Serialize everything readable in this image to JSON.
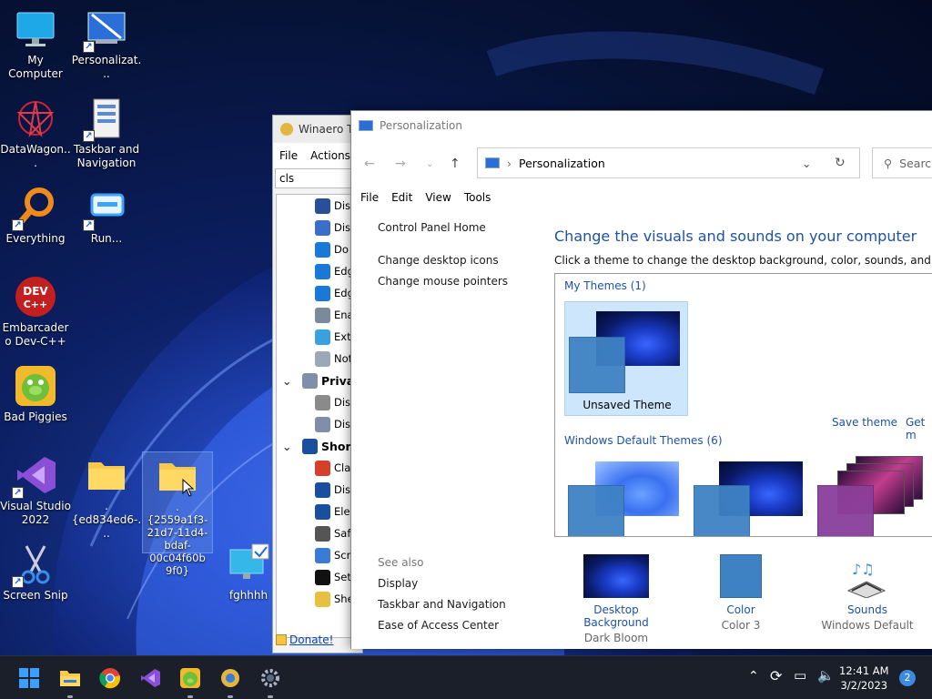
{
  "desktop": {
    "icons": [
      {
        "label": "My Computer"
      },
      {
        "label": "Personalizat..."
      },
      {
        "label": "DataWagon..."
      },
      {
        "label": "Taskbar and Navigation"
      },
      {
        "label": "Everything"
      },
      {
        "label": "Run..."
      },
      {
        "label": "Embarcadero Dev-C++"
      },
      {
        "label": "Bad Piggies"
      },
      {
        "label": "Visual Studio 2022"
      },
      {
        "label": ".{ed834ed6-..."
      },
      {
        "label": ".{2559a1f3-21d7-11d4-bdaf-00c04f60b9f0}"
      },
      {
        "label": "Screen Snip"
      },
      {
        "label": "fghhhh"
      }
    ],
    "devcpp_logo_text": "DEV C++"
  },
  "winaero": {
    "title": "Winaero Tw",
    "menu": [
      "File",
      "Actions"
    ],
    "search_value": "cls",
    "tree": [
      {
        "label": "Dis",
        "icon": "circle-icon"
      },
      {
        "label": "Dis",
        "icon": "brush-icon"
      },
      {
        "label": "Do",
        "icon": "edge-icon"
      },
      {
        "label": "Edg",
        "icon": "edge-icon"
      },
      {
        "label": "Edg",
        "icon": "edge-icon"
      },
      {
        "label": "Ena",
        "icon": "tools-icon"
      },
      {
        "label": "Ext",
        "icon": "ie-icon"
      },
      {
        "label": "Not",
        "icon": "notepad-icon"
      },
      {
        "label": "Privac",
        "icon": "shield-icon",
        "group": true
      },
      {
        "label": "Dis",
        "icon": "eye-icon"
      },
      {
        "label": "Dis",
        "icon": "shield-icon"
      },
      {
        "label": "Shortc",
        "icon": "shortcut-icon",
        "group": true
      },
      {
        "label": "Cla",
        "icon": "power-icon"
      },
      {
        "label": "Dis",
        "icon": "shortcut-icon"
      },
      {
        "label": "Ele",
        "icon": "shortcut-icon"
      },
      {
        "label": "Saf",
        "icon": "display-icon"
      },
      {
        "label": "Scr",
        "icon": "scissors-icon"
      },
      {
        "label": "Set",
        "icon": "gear-icon"
      },
      {
        "label": "She",
        "icon": "folder-icon"
      }
    ],
    "donate": "Donate!"
  },
  "personalization": {
    "title": "Personalization",
    "breadcrumb": "Personalization",
    "search_placeholder": "Searc",
    "menu": [
      "File",
      "Edit",
      "View",
      "Tools"
    ],
    "left_links": [
      "Control Panel Home",
      "Change desktop icons",
      "Change mouse pointers"
    ],
    "heading": "Change the visuals and sounds on your computer",
    "subheading": "Click a theme to change the desktop background, color, sounds, and screen sa",
    "my_themes_caption": "My Themes (1)",
    "unsaved_theme": "Unsaved Theme",
    "save_theme": "Save theme",
    "get_more": "Get m",
    "default_themes_caption": "Windows Default Themes (6)",
    "see_also": "See also",
    "see_also_links": [
      "Display",
      "Taskbar and Navigation",
      "Ease of Access Center"
    ],
    "bottom": [
      {
        "label": "Desktop Background",
        "value": "Dark Bloom"
      },
      {
        "label": "Color",
        "value": "Color 3"
      },
      {
        "label": "Sounds",
        "value": "Windows Default"
      }
    ]
  },
  "taskbar": {
    "time": "12:41 AM",
    "date": "3/2/2023",
    "notifications": "2"
  }
}
